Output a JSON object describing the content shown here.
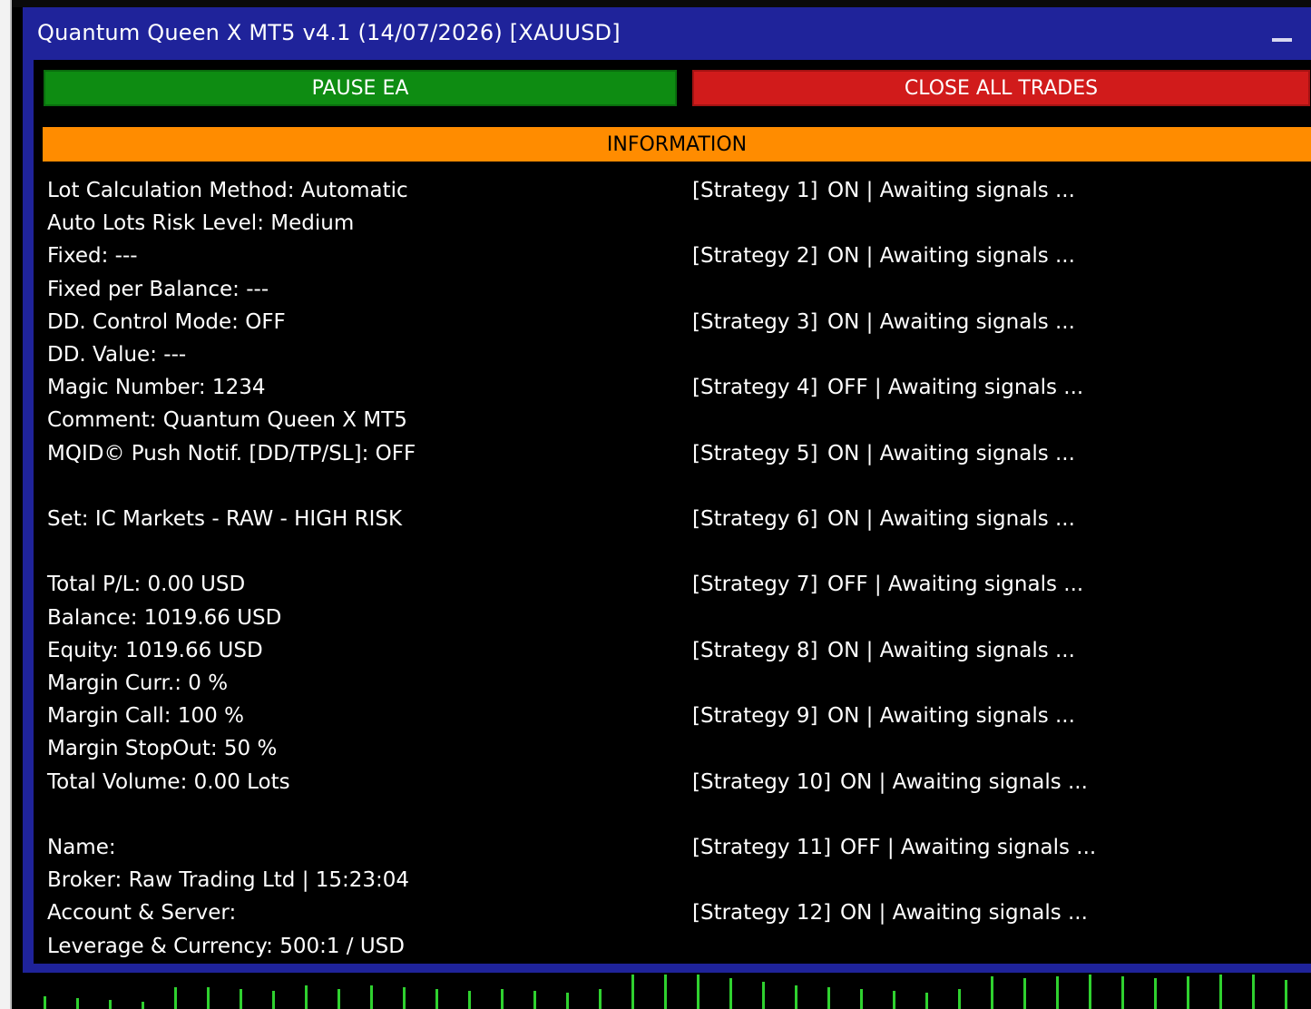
{
  "window": {
    "title": "Quantum Queen X MT5 v4.1 (14/07/2026) [XAUUSD]"
  },
  "buttons": {
    "pause": "PAUSE EA",
    "close_all": "CLOSE ALL TRADES"
  },
  "section": {
    "information": "INFORMATION"
  },
  "left_info": [
    "Lot Calculation Method: Automatic",
    "Auto Lots Risk Level: Medium",
    "Fixed: ---",
    "Fixed per Balance: ---",
    "DD. Control Mode: OFF",
    "DD. Value: ---",
    "Magic Number: 1234",
    "Comment: Quantum Queen X MT5",
    "MQID© Push Notif. [DD/TP/SL]: OFF",
    "Set: IC Markets - RAW - HIGH RISK",
    "Total P/L: 0.00 USD",
    "Balance: 1019.66 USD",
    "Equity: 1019.66 USD",
    "Margin Curr.: 0 %",
    "Margin Call: 100 %",
    "Margin StopOut: 50 %",
    "Total Volume: 0.00 Lots",
    "Name:",
    "Broker: Raw Trading Ltd | 15:23:04",
    "Account & Server:",
    "Leverage & Currency: 500:1 / USD"
  ],
  "strategies": [
    {
      "label": "[Strategy 1]",
      "status": "ON | Awaiting signals ..."
    },
    {
      "label": "[Strategy 2]",
      "status": "ON | Awaiting signals ..."
    },
    {
      "label": "[Strategy 3]",
      "status": "ON | Awaiting signals ..."
    },
    {
      "label": "[Strategy 4]",
      "status": "OFF | Awaiting signals ..."
    },
    {
      "label": "[Strategy 5]",
      "status": "ON | Awaiting signals ..."
    },
    {
      "label": "[Strategy 6]",
      "status": "ON | Awaiting signals ..."
    },
    {
      "label": "[Strategy 7]",
      "status": "OFF | Awaiting signals ..."
    },
    {
      "label": "[Strategy 8]",
      "status": "ON | Awaiting signals ..."
    },
    {
      "label": "[Strategy 9]",
      "status": "ON | Awaiting signals ..."
    },
    {
      "label": "[Strategy 10]",
      "status": "ON | Awaiting signals ..."
    },
    {
      "label": "[Strategy 11]",
      "status": "OFF | Awaiting signals ..."
    },
    {
      "label": "[Strategy 12]",
      "status": "ON | Awaiting signals ..."
    }
  ],
  "colors": {
    "panel_frame": "#1f239a",
    "pause_button": "#0e8c12",
    "close_button": "#d11b1b",
    "info_header": "#ff8c00",
    "volume_bars": "#2fd12f"
  }
}
